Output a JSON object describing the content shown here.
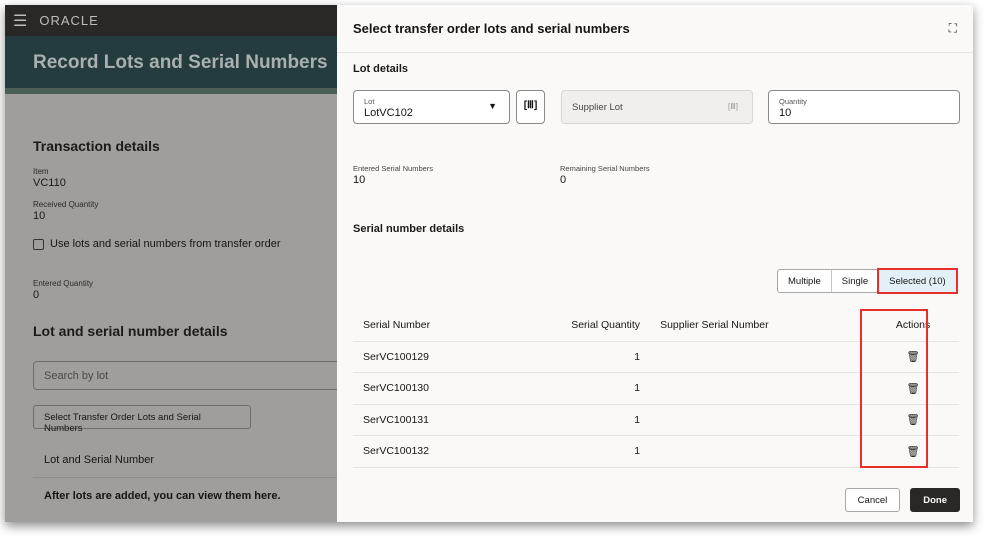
{
  "background_page": {
    "brand": "ORACLE",
    "title": "Record Lots and Serial Numbers",
    "transaction_heading": "Transaction details",
    "item_label": "Item",
    "item_value": "VC110",
    "received_label": "Received Quantity",
    "received_value": "10",
    "use_checkbox_label": "Use lots and serial numbers from transfer order",
    "entered_qty_label": "Entered Quantity",
    "entered_qty_value": "0",
    "lot_heading": "Lot and serial number details",
    "search_placeholder": "Search by lot",
    "select_button": "Select Transfer Order Lots and Serial Numbers",
    "list_header": "Lot and Serial Number",
    "empty_message": "After lots are added, you can view them here."
  },
  "modal": {
    "title": "Select transfer order lots and serial numbers",
    "lot_details_heading": "Lot details",
    "lot_label": "Lot",
    "lot_value": "LotVC102",
    "supplier_lot_placeholder": "Supplier Lot",
    "quantity_label": "Quantity",
    "quantity_value": "10",
    "entered_serial_label": "Entered Serial Numbers",
    "entered_serial_value": "10",
    "remaining_serial_label": "Remaining Serial Numbers",
    "remaining_serial_value": "0",
    "serial_heading": "Serial number details",
    "segments": [
      "Multiple",
      "Single",
      "Selected (10)"
    ],
    "columns": [
      "Serial Number",
      "Serial Quantity",
      "Supplier Serial Number",
      "Actions"
    ],
    "rows": [
      {
        "serial": "SerVC100129",
        "qty": "1",
        "supplier": ""
      },
      {
        "serial": "SerVC100130",
        "qty": "1",
        "supplier": ""
      },
      {
        "serial": "SerVC100131",
        "qty": "1",
        "supplier": ""
      },
      {
        "serial": "SerVC100132",
        "qty": "1",
        "supplier": ""
      }
    ],
    "cancel": "Cancel",
    "done": "Done"
  },
  "colors": {
    "highlight": "#e8302a",
    "primary": "#2a2826"
  }
}
